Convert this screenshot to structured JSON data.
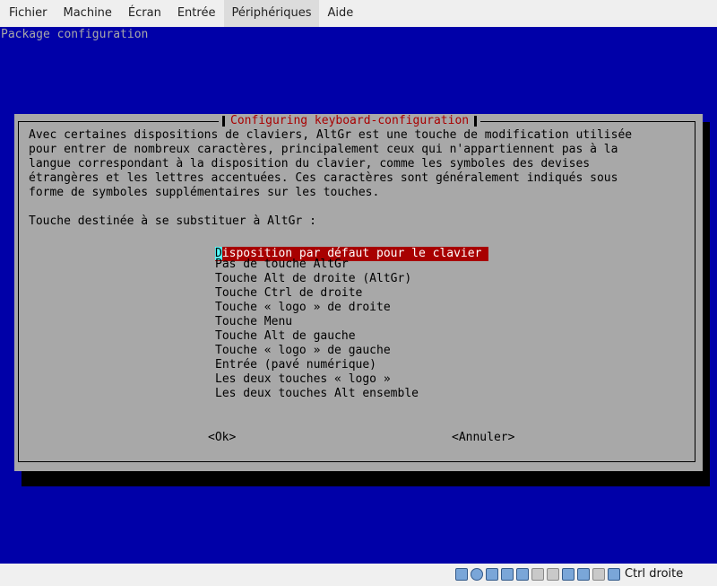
{
  "menubar": {
    "items": [
      "Fichier",
      "Machine",
      "Écran",
      "Entrée",
      "Périphériques",
      "Aide"
    ]
  },
  "screen": {
    "package_title": "Package configuration",
    "dialog": {
      "title": "Configuring keyboard-configuration",
      "description": [
        "Avec certaines dispositions de claviers, AltGr est une touche de modification utilisée",
        "pour entrer de nombreux caractères, principalement ceux qui n'appartiennent pas à la",
        "langue correspondant à la disposition du clavier, comme les symboles des devises",
        "étrangères et les lettres accentuées. Ces caractères sont généralement indiqués sous",
        "forme de symboles supplémentaires sur les touches."
      ],
      "prompt": "Touche destinée à se substituer à AltGr :",
      "selected_first_char": "D",
      "selected_rest": "isposition par défaut pour le clavier",
      "options": [
        "Pas de touche AltGr",
        "Touche Alt de droite (AltGr)",
        "Touche Ctrl de droite",
        "Touche « logo » de droite",
        "Touche Menu",
        "Touche Alt de gauche",
        "Touche « logo » de gauche",
        "Entrée (pavé numérique)",
        "Les deux touches « logo »",
        "Les deux touches Alt ensemble"
      ],
      "ok_label": "<Ok>",
      "cancel_label": "<Annuler>"
    }
  },
  "statusbar": {
    "host_key": "Ctrl droite",
    "icons": [
      "hard-disk-icon",
      "optical-drive-icon",
      "audio-icon",
      "network-icon",
      "usb-icon",
      "shared-folder-icon",
      "display-icon",
      "video-capture-icon",
      "mouse-integration-icon",
      "keyboard-capture-icon",
      "host-key-arrow-icon"
    ]
  },
  "colors": {
    "console_background": "#0000a8",
    "dialog_background": "#a8a8a8",
    "title_red": "#a80000",
    "selection_background": "#a80000",
    "cursor_cyan": "#54fcfc"
  }
}
